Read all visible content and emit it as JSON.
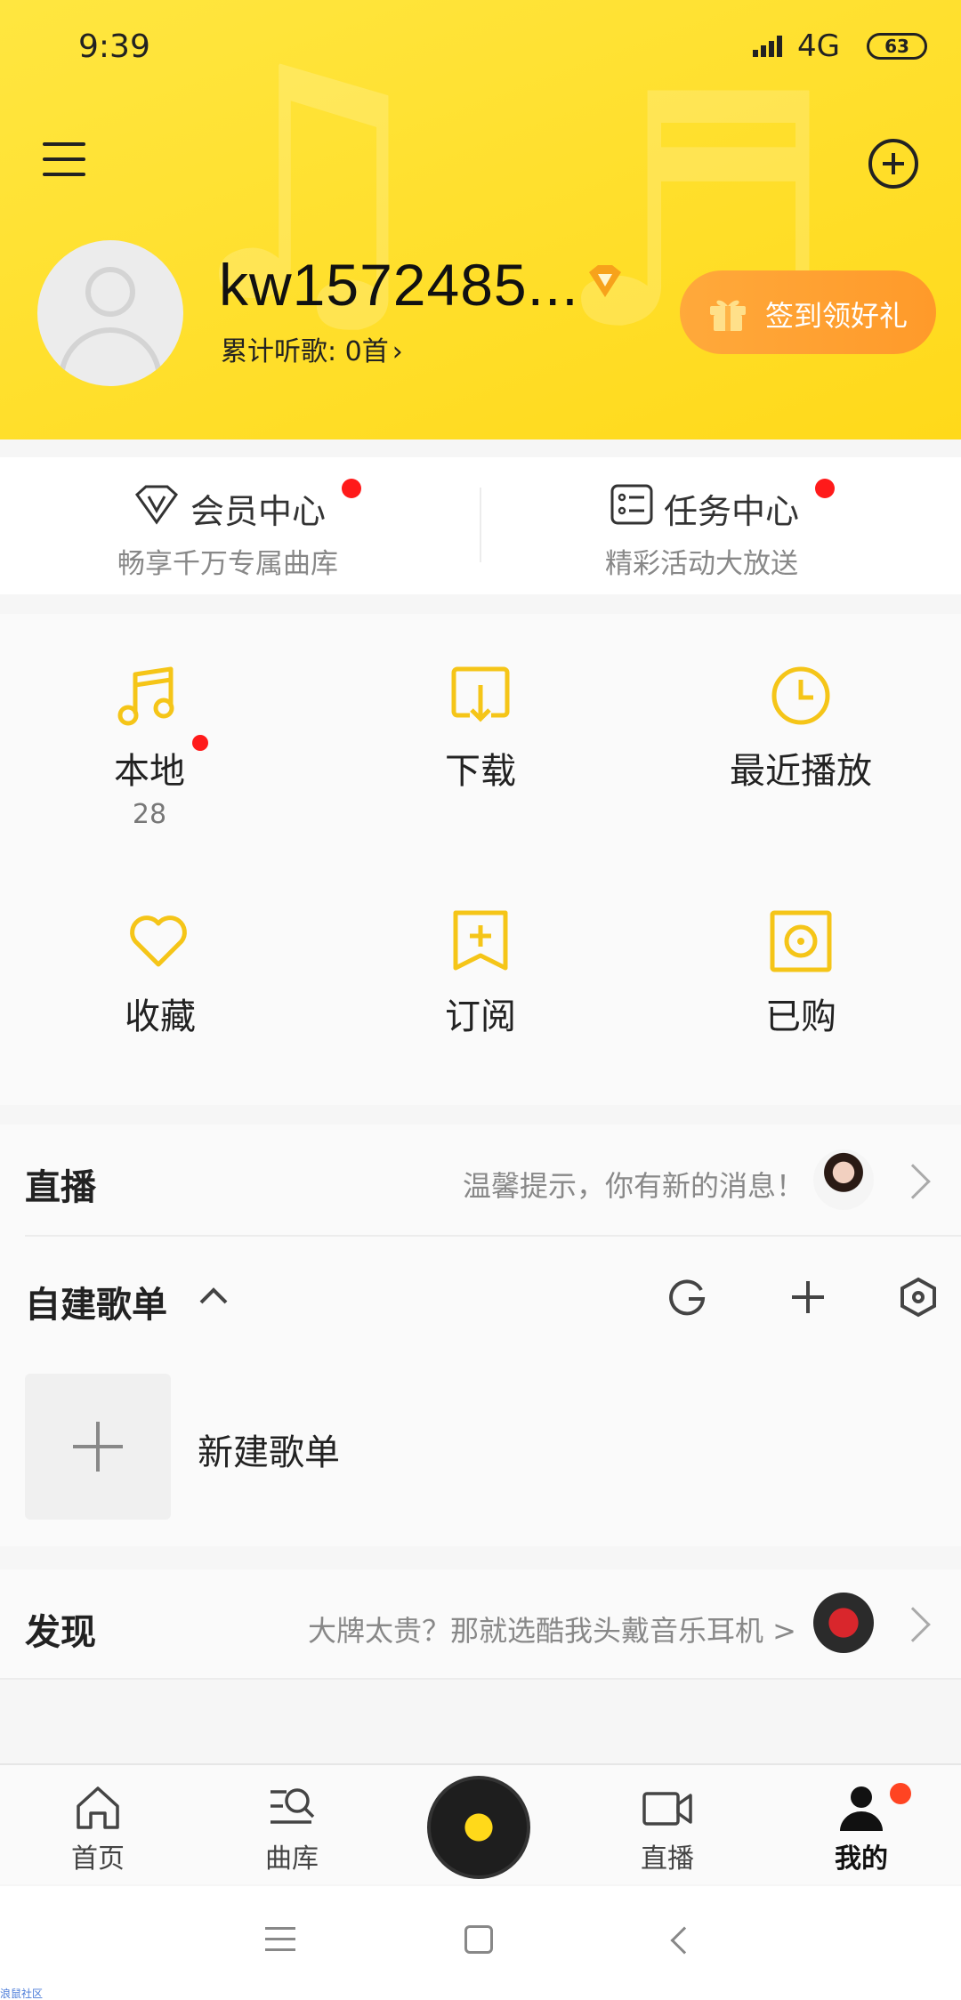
{
  "status_bar": {
    "time": "9:39",
    "network": "4G",
    "battery": "63"
  },
  "profile": {
    "username": "kw1572485...",
    "listen_count": "累计听歌: 0首",
    "checkin_label": "签到领好礼"
  },
  "member": {
    "vip_title": "会员中心",
    "vip_sub": "畅享千万专属曲库",
    "task_title": "任务中心",
    "task_sub": "精彩活动大放送"
  },
  "grid": {
    "local_label": "本地",
    "local_count": "28",
    "download_label": "下载",
    "recent_label": "最近播放",
    "favorite_label": "收藏",
    "subscribe_label": "订阅",
    "purchased_label": "已购"
  },
  "live": {
    "title": "直播",
    "tip": "温馨提示，你有新的消息！"
  },
  "playlist": {
    "title": "自建歌单",
    "new_label": "新建歌单"
  },
  "discover": {
    "title": "发现",
    "tip": "大牌太贵？那就选酷我头戴音乐耳机 >"
  },
  "tabs": {
    "home": "首页",
    "library": "曲库",
    "live": "直播",
    "mine": "我的"
  },
  "watermark": "浪鼠社区",
  "colors": {
    "accent": "#ffd91a",
    "checkin": "#ffa93b",
    "badge": "#ff1a1a",
    "icon_yellow": "#f5c518"
  }
}
